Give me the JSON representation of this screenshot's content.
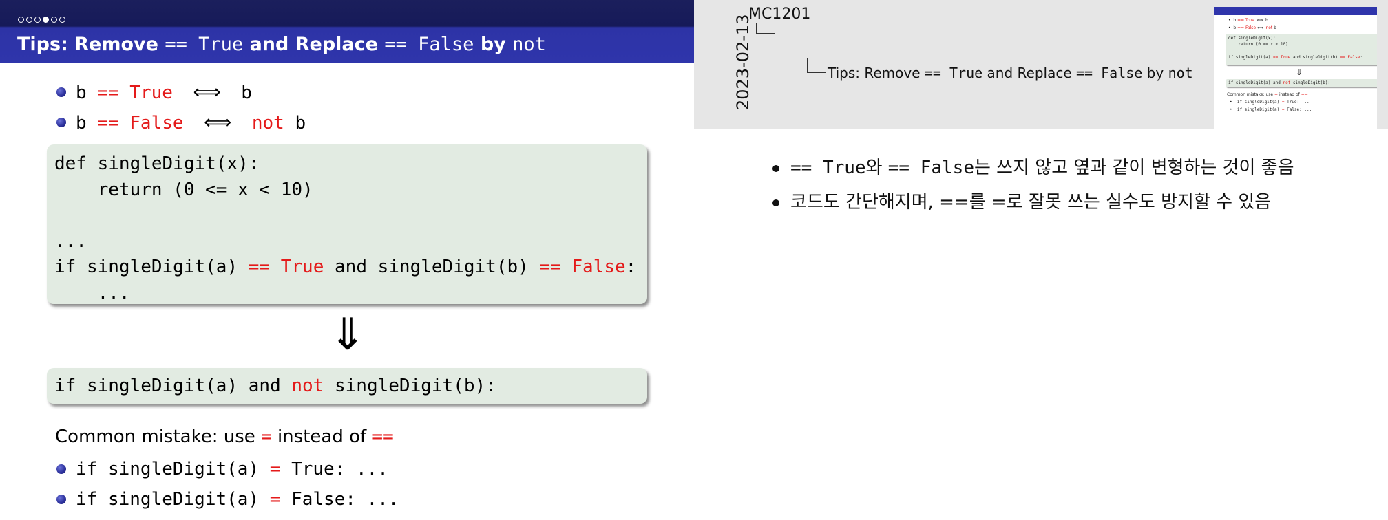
{
  "slide": {
    "title_prefix": "Tips: Remove ",
    "title_code1": "== True",
    "title_mid": " and Replace ",
    "title_code2": "== False",
    "title_by": " by ",
    "title_code3": "not",
    "bullets": [
      {
        "b": "b",
        "op": "== True",
        "arrow": "⟺",
        "rhs_kw": "",
        "rhs": "b"
      },
      {
        "b": "b",
        "op": "== False",
        "arrow": "⟺",
        "rhs_kw": "not",
        "rhs": "b"
      }
    ],
    "code_block_1": {
      "line1": "def singleDigit(x):",
      "line2": "    return (0 <= x < 10)",
      "line3": "",
      "line4": "...",
      "line5_a": "if singleDigit(a) ",
      "line5_op1": "==",
      "line5_kw1": " True",
      "line5_b": " and singleDigit(b) ",
      "line5_op2": "==",
      "line5_kw2": " False",
      "line5_c": ":",
      "line6": "    ..."
    },
    "down_arrow": "⇓",
    "code_block_2": {
      "a": "if singleDigit(a) and ",
      "kw": "not",
      "b": " singleDigit(b):"
    },
    "mistake": {
      "prefix": "Common mistake: use ",
      "eq": "=",
      "mid": " instead of ",
      "eqeq": "=="
    },
    "mistake_bullets": [
      {
        "a": "if singleDigit(a) ",
        "eq": "=",
        "b": " True: ..."
      },
      {
        "a": "if singleDigit(a) ",
        "eq": "=",
        "b": " False: ..."
      }
    ],
    "nav_dots": [
      false,
      false,
      false,
      true,
      false,
      false
    ]
  },
  "notes": {
    "date": "2023-02-13",
    "section": "MC1201",
    "subsection_prefix": "Tips: Remove ",
    "subsection_code1": "== True",
    "subsection_mid": " and Replace ",
    "subsection_code2": "== False",
    "subsection_by": " by ",
    "subsection_code3": "not",
    "bullets": [
      {
        "code1": "== True",
        "text1": "와 ",
        "code2": "== False",
        "text2": "는 쓰지 않고 옆과 같이 변형하는 것이 좋음"
      },
      {
        "code1": "",
        "text1": "코드도 간단해지며, ==를 =로 잘못 쓰는 실수도 방지할 수 있음",
        "code2": "",
        "text2": ""
      }
    ]
  },
  "colors": {
    "header_blue": "#2f35ab",
    "header_dark": "#161a59",
    "keyword_red": "#e41a1a",
    "code_bg": "#e2ebe2",
    "notes_bg": "#e6e6e6"
  }
}
